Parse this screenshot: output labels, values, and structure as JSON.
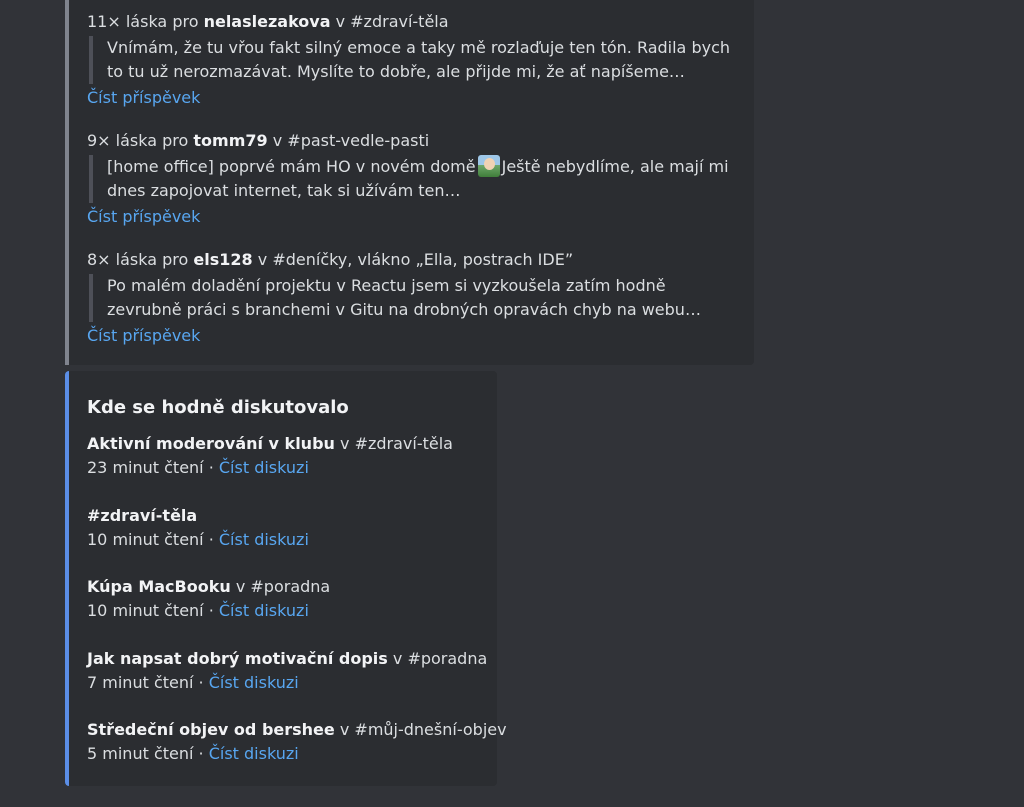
{
  "love": {
    "items": [
      {
        "count": "11× láska pro",
        "user": "nelaslezakova",
        "channel": "v #zdraví-těla",
        "quote": [
          "Vnímám, že tu vřou fakt silný emoce a taky mě rozlaďuje ten tón. Radila bych",
          "to tu už nerozmazávat. Myslíte to dobře, ale přijde mi, že ať napíšeme…"
        ],
        "link": "Číst příspěvek"
      },
      {
        "count": "9× láska pro",
        "user": "tomm79",
        "channel": "v #past-vedle-pasti",
        "quote_a": "[home office] poprvé mám HO v novém domě",
        "quote_b": "Ještě nebydlíme, ale mají mi",
        "quote_c": "dnes zapojovat internet, tak si užívám ten…",
        "emoji": "baby-emoji",
        "link": "Číst příspěvek"
      },
      {
        "count": "8× láska pro",
        "user": "els128",
        "channel": "v #deníčky, vlákno „Ella, postrach IDE”",
        "quote": [
          "Po malém doladění projektu v Reactu jsem si vyzkoušela zatím hodně",
          "zevrubně práci s branchemi v Gitu na drobných opravách chyb na webu…"
        ],
        "link": "Číst příspěvek"
      }
    ]
  },
  "discussions": {
    "title": "Kde se hodně diskutovalo",
    "items": [
      {
        "topic": "Aktivní moderování v klubu",
        "channel": " v #zdraví-těla",
        "time": "23 minut čtení · ",
        "link": "Číst diskuzi"
      },
      {
        "topic": "#zdraví-těla",
        "channel": "",
        "time": "10 minut čtení · ",
        "link": "Číst diskuzi"
      },
      {
        "topic": "Kúpa MacBooku",
        "channel": " v #poradna",
        "time": "10 minut čtení · ",
        "link": "Číst diskuzi"
      },
      {
        "topic": "Jak napsat dobrý motivační dopis",
        "channel": " v #poradna",
        "time": "7 minut čtení · ",
        "link": "Číst diskuzi"
      },
      {
        "topic": "Středeční objev od bershee",
        "channel": " v #můj-dnešní-objev",
        "time": "5 minut čtení · ",
        "link": "Číst diskuzi"
      }
    ]
  },
  "colors": {
    "background": "#313338",
    "card": "#2b2d31",
    "link": "#58a6f0",
    "accent_blue": "#5b8ee6",
    "accent_gray": "#80848e"
  }
}
